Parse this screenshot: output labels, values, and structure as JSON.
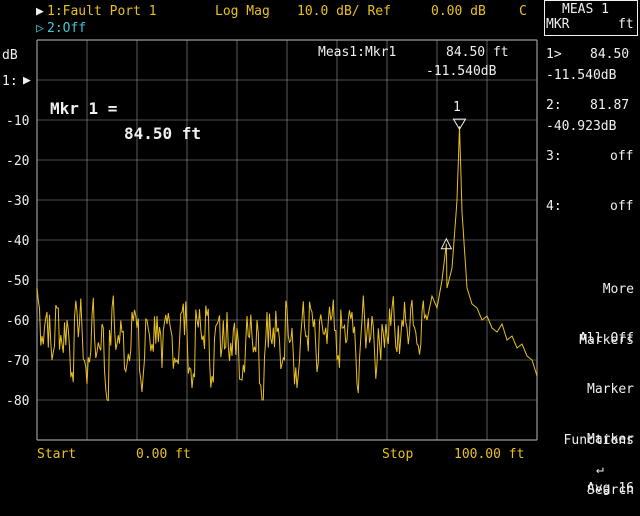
{
  "header": {
    "trace1_label": "1:Fault Port 1",
    "format": "Log Mag",
    "scale": "10.0 dB/ Ref",
    "ref_value": "0.00 dB",
    "cal_flag": "C",
    "trace2_label": "2:Off"
  },
  "axis": {
    "unit": "dB",
    "ref_marker": "1:",
    "y_ticks": [
      "-10",
      "-20",
      "-30",
      "-40",
      "-50",
      "-60",
      "-70",
      "-80"
    ]
  },
  "marker_readout": {
    "label": "Meas1:Mkr1",
    "position": "84.50 ft",
    "value": "-11.540dB"
  },
  "marker_big": {
    "line1": "Mkr 1 =",
    "line2": "84.50 ft",
    "marker1_tag": "1"
  },
  "footer": {
    "start_label": "Start",
    "start_value": "0.00 ft",
    "stop_label": "Stop",
    "stop_value": "100.00 ft"
  },
  "side_panel": {
    "meas_title": "MEAS 1",
    "meas_sub": "MKR",
    "meas_unit": "ft",
    "m1_idx": "1>",
    "m1_pos": "84.50",
    "m1_val": "-11.540dB",
    "m2_idx": "2:",
    "m2_pos": "81.87",
    "m2_val": "-40.923dB",
    "m3_idx": "3:",
    "m3_state": "off",
    "m4_idx": "4:",
    "m4_state": "off",
    "more_markers_l1": "More",
    "more_markers_l2": "Markers",
    "all_off": "All Off",
    "marker_functions_l1": "Marker",
    "marker_functions_l2": "Functions",
    "marker_search_l1": "Marker",
    "marker_search_l2": "Search",
    "avg": "Avg 16",
    "return_glyph": "↵"
  },
  "colors": {
    "trace": "#e8c020",
    "grid": "#9a9a9a",
    "text": "#f0f0f0",
    "trace2": "#40c8d8"
  },
  "chart_data": {
    "type": "line",
    "xlabel": "",
    "ylabel": "dB",
    "xlim": [
      0,
      100
    ],
    "ylim": [
      -90,
      10
    ],
    "x_unit": "ft",
    "series": [
      {
        "x": [
          0,
          1,
          2,
          3,
          4,
          5,
          6,
          7,
          8,
          9,
          10,
          11,
          12,
          13,
          14,
          15,
          16,
          17,
          18,
          19,
          20,
          21,
          22,
          23,
          24,
          25,
          26,
          27,
          28,
          29,
          30,
          31,
          32,
          33,
          34,
          35,
          36,
          37,
          38,
          39,
          40,
          41,
          42,
          43,
          44,
          45,
          46,
          47,
          48,
          49,
          50,
          51,
          52,
          53,
          54,
          55,
          56,
          57,
          58,
          59,
          60,
          61,
          62,
          63,
          64,
          65,
          66,
          67,
          68,
          69,
          70,
          71,
          72,
          73,
          74,
          75,
          76,
          77,
          78,
          79,
          80,
          81,
          81.87,
          82,
          83,
          84,
          84.5,
          85,
          86,
          87,
          88,
          89,
          90,
          91,
          92,
          93,
          94,
          95,
          96,
          97,
          98,
          99,
          100
        ],
        "y": [
          -52,
          -64,
          -58,
          -70,
          -57,
          -66,
          -60,
          -73,
          -58,
          -62,
          -76,
          -59,
          -68,
          -61,
          -80,
          -57,
          -66,
          -63,
          -71,
          -58,
          -62,
          -78,
          -60,
          -66,
          -59,
          -72,
          -61,
          -64,
          -70,
          -58,
          -63,
          -77,
          -60,
          -65,
          -59,
          -74,
          -61,
          -67,
          -58,
          -69,
          -62,
          -75,
          -59,
          -64,
          -60,
          -80,
          -58,
          -66,
          -63,
          -71,
          -57,
          -62,
          -77,
          -60,
          -64,
          -58,
          -73,
          -61,
          -66,
          -59,
          -70,
          -62,
          -65,
          -58,
          -76,
          -60,
          -63,
          -59,
          -71,
          -61,
          -64,
          -57,
          -68,
          -60,
          -62,
          -55,
          -66,
          -58,
          -60,
          -54,
          -57,
          -50,
          -40.923,
          -52,
          -47,
          -30,
          -11.54,
          -33,
          -52,
          -56,
          -57,
          -60,
          -59,
          -62,
          -63,
          -61,
          -65,
          -64,
          -67,
          -66,
          -69,
          -70,
          -74
        ]
      }
    ]
  }
}
